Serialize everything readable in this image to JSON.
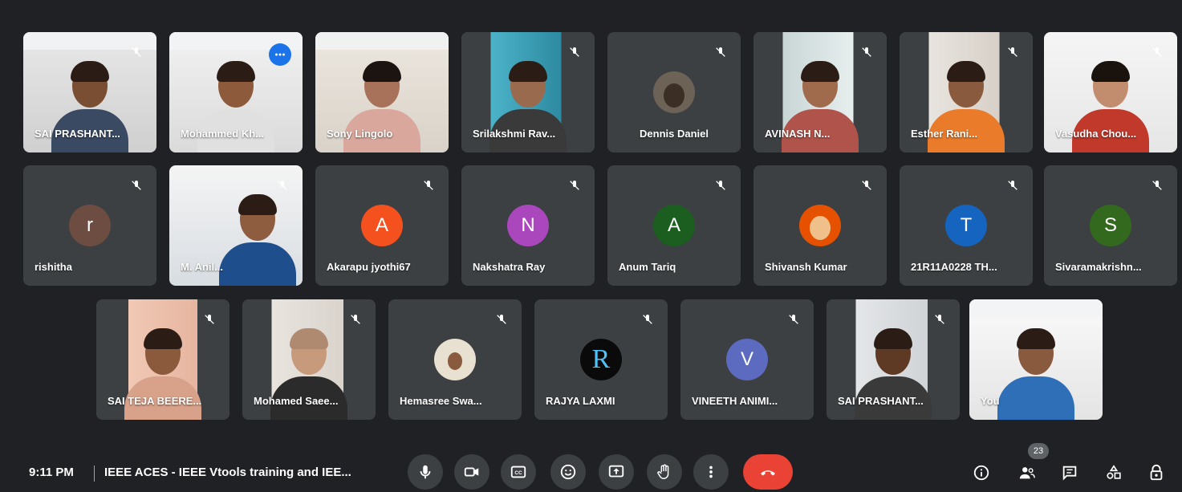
{
  "participants": [
    {
      "name": "SAI PRASHANT...",
      "type": "video"
    },
    {
      "name": "Mohammed Kh...",
      "type": "video",
      "speaking": true
    },
    {
      "name": "Sony Lingolo",
      "type": "video"
    },
    {
      "name": "Srilakshmi Rav...",
      "type": "video"
    },
    {
      "name": "Dennis Daniel",
      "type": "photo"
    },
    {
      "name": "AVINASH N...",
      "type": "video"
    },
    {
      "name": "Esther Rani...",
      "type": "video"
    },
    {
      "name": "Vasudha Chou...",
      "type": "video"
    },
    {
      "name": "rishitha",
      "initial": "r",
      "color": "#6d4c41"
    },
    {
      "name": "M. Anil...",
      "type": "video"
    },
    {
      "name": "Akarapu jyothi67",
      "initial": "A",
      "color": "#f4511e"
    },
    {
      "name": "Nakshatra Ray",
      "initial": "N",
      "color": "#ab47bc"
    },
    {
      "name": "Anum Tariq",
      "initial": "A",
      "color": "#1b5e20"
    },
    {
      "name": "Shivansh Kumar",
      "type": "photo"
    },
    {
      "name": "21R11A0228 TH...",
      "initial": "T",
      "color": "#1565c0"
    },
    {
      "name": "Sivaramakrishn...",
      "initial": "S",
      "color": "#33691e"
    },
    {
      "name": "SAI TEJA BEERE...",
      "type": "video"
    },
    {
      "name": "Mohamed Saee...",
      "type": "video"
    },
    {
      "name": "Hemasree Swa...",
      "type": "photo"
    },
    {
      "name": "RAJYA LAXMI",
      "type": "logo",
      "initial": "R"
    },
    {
      "name": "VINEETH ANIMI...",
      "initial": "V",
      "color": "#5c6bc0"
    },
    {
      "name": "SAI PRASHANT...",
      "type": "video"
    },
    {
      "name": "You",
      "type": "video"
    }
  ],
  "bottom_bar": {
    "time": "9:11 PM",
    "meeting_title": "IEEE ACES - IEEE Vtools training and IEE...",
    "participant_count": "23"
  },
  "colors": {
    "background": "#202124",
    "tile": "#3c4043",
    "end_call": "#ea4335",
    "speaking_border": "#8ab4f8"
  }
}
